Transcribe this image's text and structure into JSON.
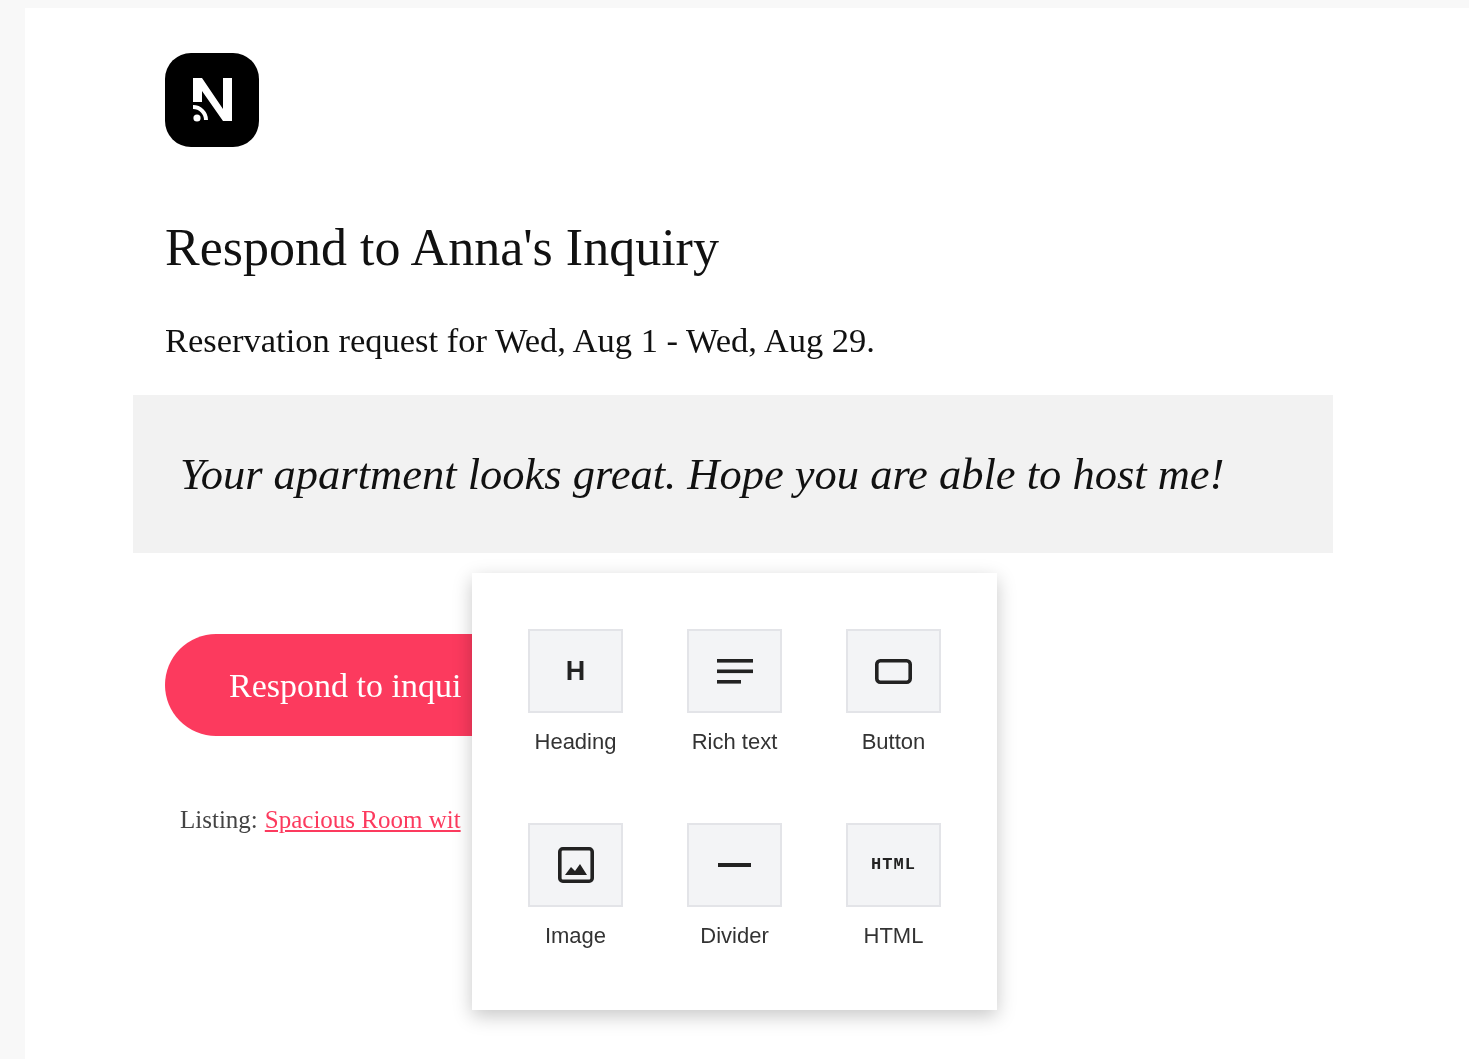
{
  "title": "Respond to Anna's Inquiry",
  "subtitle": "Reservation request for Wed, Aug 1 - Wed, Aug 29.",
  "message": "Your apartment looks great. Hope you are able to host me!",
  "cta_button": {
    "label": "Respond to inqui"
  },
  "listing": {
    "label": "Listing:",
    "link": "Spacious Room wit"
  },
  "block_menu": {
    "items": [
      {
        "kind": "heading",
        "glyph": "H",
        "label": "Heading"
      },
      {
        "kind": "rich_text",
        "label": "Rich text"
      },
      {
        "kind": "button",
        "label": "Button"
      },
      {
        "kind": "image",
        "label": "Image"
      },
      {
        "kind": "divider",
        "label": "Divider"
      },
      {
        "kind": "html",
        "glyph": "HTML",
        "label": "HTML"
      }
    ]
  }
}
